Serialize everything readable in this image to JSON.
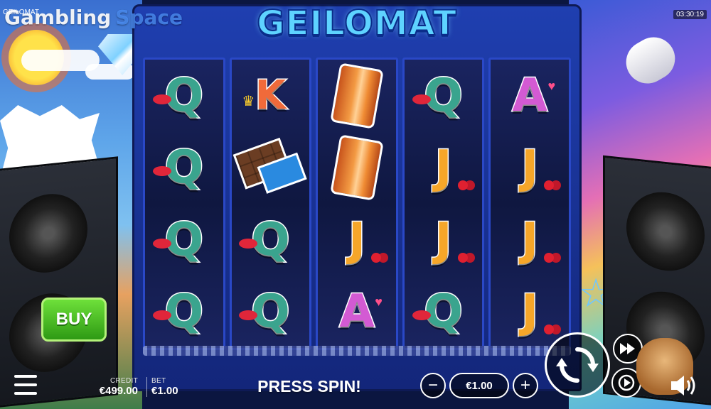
{
  "window": {
    "title_small": "GEILOMAT",
    "clock": "03:30:19"
  },
  "watermark": {
    "part1": "Gambling",
    "part2": "Space"
  },
  "game": {
    "logo_text": "GEILOMAT"
  },
  "reels": [
    [
      "Q",
      "Q",
      "Q",
      "Q"
    ],
    [
      "K",
      "chocolate-bar",
      "Q",
      "Q"
    ],
    [
      "orange-can",
      "orange-can",
      "J",
      "A"
    ],
    [
      "Q",
      "J",
      "J",
      "Q"
    ],
    [
      "A",
      "J",
      "J",
      "J"
    ]
  ],
  "buttons": {
    "buy_label": "BUY",
    "minus_label": "−",
    "plus_label": "+",
    "spin_icon": "spin-arrows-icon",
    "turbo_icon": "fast-forward-icon",
    "autoplay_icon": "autoplay-icon",
    "sound_icon": "speaker-icon",
    "menu_icon": "hamburger-menu-icon"
  },
  "hud": {
    "credit_label": "CREDIT",
    "credit_value": "€499.00",
    "bet_label": "BET",
    "bet_value": "€1.00",
    "message": "PRESS SPIN!",
    "bet_selector_value": "€1.00"
  },
  "colors": {
    "cabinet": "#1f3fb0",
    "buy_green": "#3fb81f",
    "logo_blue": "#5ed3ff"
  }
}
